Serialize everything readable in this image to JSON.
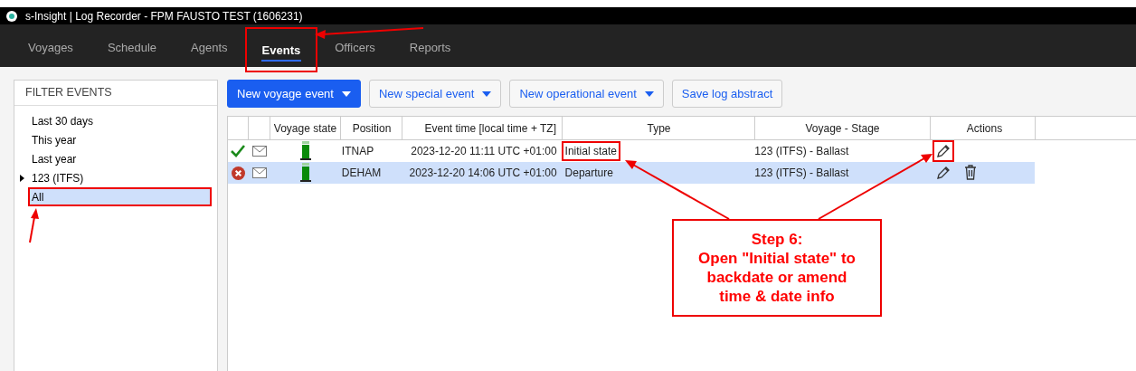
{
  "window": {
    "title": "s-Insight | Log Recorder - FPM FAUSTO TEST (1606231)"
  },
  "tabs": [
    {
      "label": "Voyages",
      "selected": false,
      "highlighted": false
    },
    {
      "label": "Schedule",
      "selected": false,
      "highlighted": false
    },
    {
      "label": "Agents",
      "selected": false,
      "highlighted": false
    },
    {
      "label": "Events",
      "selected": true,
      "highlighted": true
    },
    {
      "label": "Officers",
      "selected": false,
      "highlighted": false
    },
    {
      "label": "Reports",
      "selected": false,
      "highlighted": false
    }
  ],
  "sidebar": {
    "title": "FILTER EVENTS",
    "items": [
      {
        "label": "Last 30 days",
        "selected": false,
        "highlighted": false
      },
      {
        "label": "This year",
        "selected": false,
        "highlighted": false
      },
      {
        "label": "Last year",
        "selected": false,
        "highlighted": false
      },
      {
        "label": "123 (ITFS)",
        "selected": false,
        "highlighted": false,
        "expanded": false
      },
      {
        "label": "All",
        "selected": true,
        "highlighted": true
      }
    ]
  },
  "toolbar": [
    {
      "label": "New voyage event",
      "kind": "primary"
    },
    {
      "label": "New special event",
      "kind": "dropdown"
    },
    {
      "label": "New operational event",
      "kind": "dropdown"
    },
    {
      "label": "Save log abstract",
      "kind": "plain"
    }
  ],
  "table": {
    "columns": [
      "Voyage state",
      "Position",
      "Event time [local time + TZ]",
      "Type",
      "Voyage - Stage",
      "Actions"
    ],
    "rows": [
      {
        "approved": true,
        "selected": false,
        "position": "ITNAP",
        "event_time": "2023-12-20 11:11  UTC +01:00",
        "type": "Initial state",
        "type_highlighted": true,
        "voyage_stage": "123 (ITFS) - Ballast",
        "actions": [
          {
            "kind": "edit",
            "highlighted": true
          }
        ]
      },
      {
        "approved": false,
        "selected": true,
        "position": "DEHAM",
        "event_time": "2023-12-20 14:06  UTC +01:00",
        "type": "Departure",
        "type_highlighted": false,
        "voyage_stage": "123 (ITFS) - Ballast",
        "actions": [
          {
            "kind": "edit",
            "highlighted": false
          },
          {
            "kind": "delete",
            "highlighted": false
          }
        ]
      }
    ]
  },
  "callout": {
    "lines": [
      "Step 6:",
      "Open \"Initial state\" to",
      "backdate or amend",
      "time & date info"
    ]
  }
}
